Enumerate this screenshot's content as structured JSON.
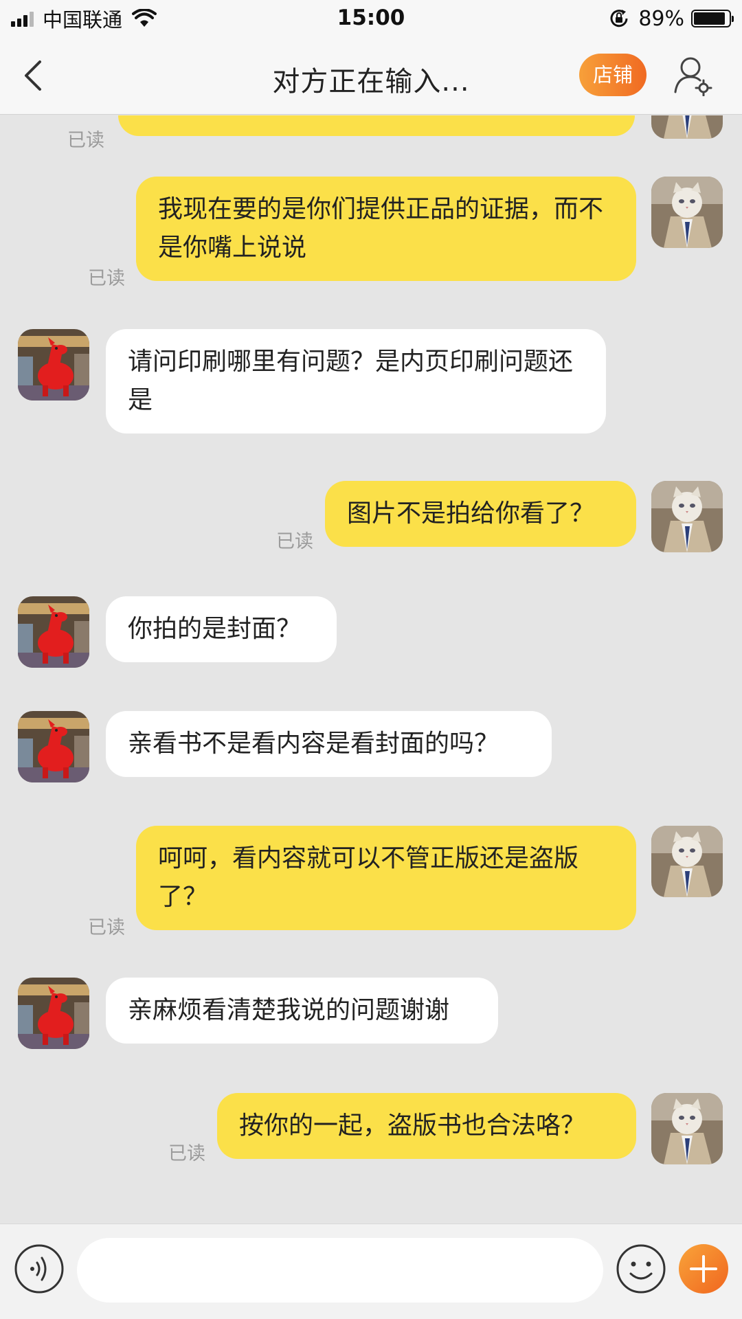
{
  "status_bar": {
    "carrier": "中国联通",
    "time": "15:00",
    "battery_percent": "89%",
    "battery_level": 0.89
  },
  "nav": {
    "title": "对方正在输入...",
    "shop_label": "店铺"
  },
  "chat": {
    "read_label": "已读",
    "messages": [
      {
        "sender": "me",
        "text": "我现在要的是你们提供正品的证据，而不是你嘴上说说",
        "read": true
      },
      {
        "sender": "them",
        "text": "请问印刷哪里有问题？是内页印刷问题还是"
      },
      {
        "sender": "me",
        "text": "图片不是拍给你看了？",
        "read": true
      },
      {
        "sender": "them",
        "text": "你拍的是封面？"
      },
      {
        "sender": "them",
        "text": "亲看书不是看内容是看封面的吗？"
      },
      {
        "sender": "me",
        "text": "呵呵，看内容就可以不管正版还是盗版了？",
        "read": true
      },
      {
        "sender": "them",
        "text": "亲麻烦看清楚我说的问题谢谢"
      },
      {
        "sender": "me",
        "text": "按你的一起，盗版书也合法咯？",
        "read": true
      }
    ]
  },
  "input": {
    "value": "",
    "placeholder": ""
  },
  "colors": {
    "my_bubble": "#fbe049",
    "their_bubble": "#ffffff",
    "accent_orange": "#f07a2a",
    "background": "#e5e5e5"
  },
  "icons": {
    "back": "chevron-left-icon",
    "profile_settings": "user-gear-icon",
    "voice": "voice-icon",
    "emoji": "smiley-icon",
    "plus": "plus-icon"
  }
}
